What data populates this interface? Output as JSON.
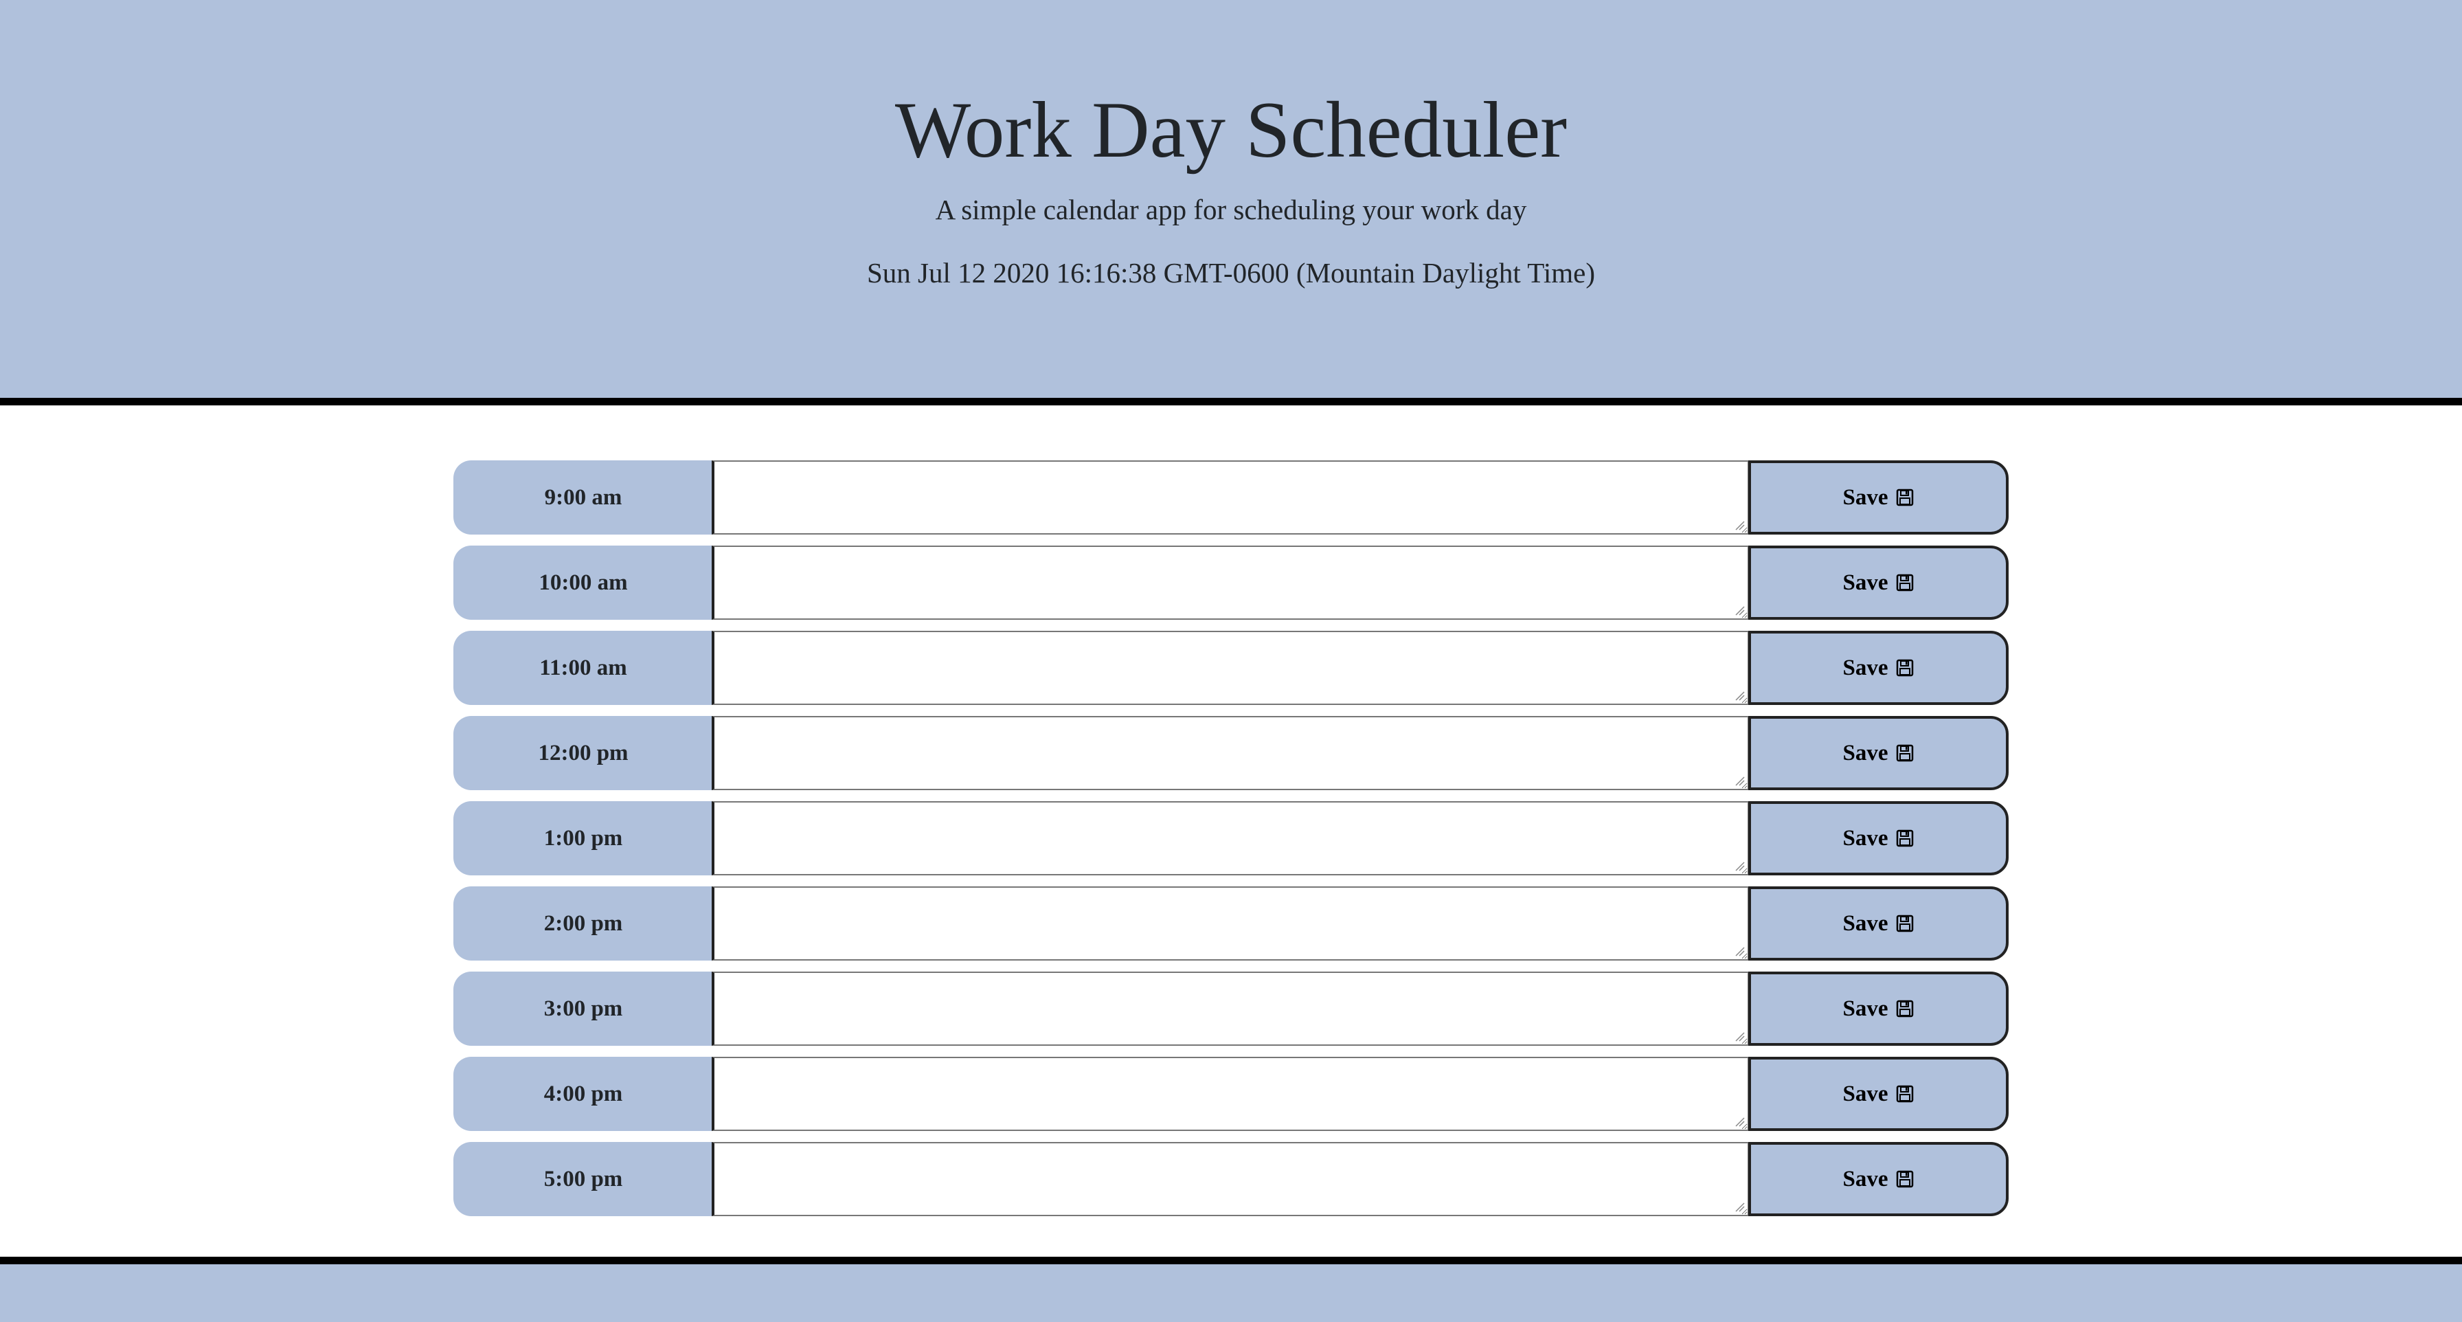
{
  "header": {
    "title": "Work Day Scheduler",
    "subtitle": "A simple calendar app for scheduling your work day",
    "current_day": "Sun Jul 12 2020 16:16:38 GMT-0600 (Mountain Daylight Time)"
  },
  "save_label": "Save",
  "save_icon": "save-icon",
  "colors": {
    "header_bg": "#b0c1dc",
    "border": "#000000"
  },
  "time_blocks": [
    {
      "hour": "9:00 am",
      "description": ""
    },
    {
      "hour": "10:00 am",
      "description": ""
    },
    {
      "hour": "11:00 am",
      "description": ""
    },
    {
      "hour": "12:00 pm",
      "description": ""
    },
    {
      "hour": "1:00 pm",
      "description": ""
    },
    {
      "hour": "2:00 pm",
      "description": ""
    },
    {
      "hour": "3:00 pm",
      "description": ""
    },
    {
      "hour": "4:00 pm",
      "description": ""
    },
    {
      "hour": "5:00 pm",
      "description": ""
    }
  ]
}
